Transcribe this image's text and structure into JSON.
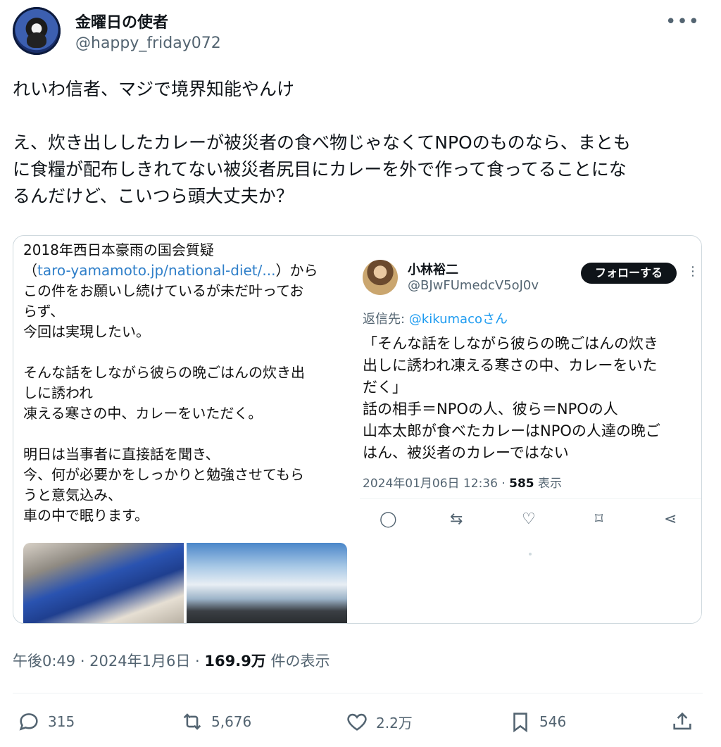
{
  "author": {
    "display_name": "金曜日の使者",
    "handle": "@happy_friday072",
    "more_icon": "more-horizontal-icon"
  },
  "tweet": {
    "line1": "れいわ信者、マジで境界知能やんけ",
    "line2": "え、炊き出ししたカレーが被災者の食べ物じゃなくてNPOのものなら、まとも",
    "line3": "に食糧が配布しきれてない被災者尻目にカレーを外で作って食ってることにな",
    "line4": "るんだけど、こいつら頭大丈夫か？"
  },
  "embedded_image": {
    "left_text": {
      "l1": "2018年西日本豪雨の国会質疑",
      "l2_open": "（",
      "l2_link": "taro-yamamoto.jp/national-diet/...",
      "l2_close": "）から",
      "l3": "この件をお願いし続けているが未だ叶ってお",
      "l4": "らず、",
      "l5": "今回は実現したい。",
      "l6": "そんな話をしながら彼らの晩ごはんの炊き出",
      "l7": "しに誘われ",
      "l8": "凍える寒さの中、カレーをいただく。",
      "l9": "明日は当事者に直接話を聞き、",
      "l10": "今、何が必要かをしっかりと勉強させてもら",
      "l11": "うと意気込み、",
      "l12": "車の中で眠ります。"
    },
    "reply_card": {
      "name": "小林裕二",
      "handle": "@BJwFUmedcV5oJ0v",
      "follow_label": "フォローする",
      "reply_prefix": "返信先: ",
      "reply_mention": "@kikumacoさん",
      "t1": "「そんな話をしながら彼らの晩ごはんの炊き",
      "t2": "出しに誘われ凍える寒さの中、カレーをいた",
      "t3": "だく」",
      "t4": "話の相手＝NPOの人、彼ら＝NPOの人",
      "t5": "山本太郎が食べたカレーはNPOの人達の晩ご",
      "t6": "はん、被災者のカレーではない",
      "meta_date": "2024年01月06日 12:36 · ",
      "meta_views": "585",
      "meta_views_label": " 表示"
    }
  },
  "timestamp": {
    "time": "午後0:49 · 2024年1月6日 · ",
    "views": "169.9万",
    "views_label": " 件の表示"
  },
  "actions": {
    "replies": "315",
    "reposts": "5,676",
    "likes": "2.2万",
    "bookmarks": "546"
  },
  "colors": {
    "link": "#1d9bf0",
    "muted": "#536471",
    "text": "#0f1419"
  }
}
